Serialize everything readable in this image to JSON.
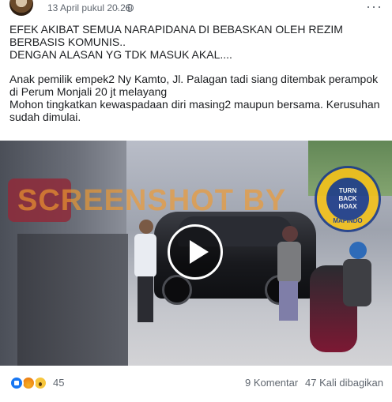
{
  "post": {
    "timestamp": "13 April pukul 20.26",
    "separator": "·",
    "more": "···",
    "text_block_1": "EFEK AKIBAT SEMUA NARAPIDANA DI BEBASKAN OLEH REZIM BERBASIS KOMUNIS..\nDENGAN ALASAN YG TDK MASUK AKAL....",
    "text_block_2": "Anak pemilik empek2 Ny Kamto, Jl. Palagan tadi siang ditembak perampok di Perum Monjali 20 jt melayang\nMohon tingkatkan kewaspadaan diri masing2 maupun bersama. Kerusuhan sudah dimulai."
  },
  "video": {
    "watermark": "SCREENSHOT BY",
    "logo": {
      "line1": "TURN",
      "line2": "BACK",
      "line3": "HOAX",
      "brand": "MAFINDO"
    }
  },
  "footer": {
    "reaction_count": "45",
    "comments": "9 Komentar",
    "shares": "47 Kali dibagikan"
  },
  "colors": {
    "text": "#1c1e21",
    "meta": "#606770",
    "watermark": "#f29a2e",
    "like": "#1877f2"
  }
}
